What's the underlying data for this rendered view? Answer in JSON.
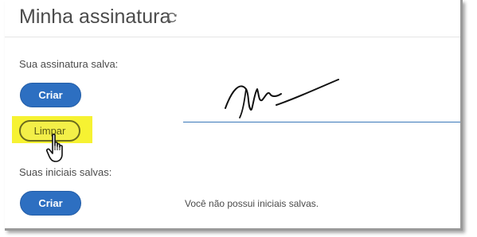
{
  "page": {
    "title": "Minha assinatura"
  },
  "signature": {
    "label": "Sua assinatura salva:",
    "create_label": "Criar",
    "clear_label": "Limpar"
  },
  "initials": {
    "label": "Suas iniciais salvas:",
    "create_label": "Criar",
    "empty_message": "Você não possui iniciais salvas."
  },
  "icons": {
    "refresh": "refresh-icon",
    "cursor": "hand-pointer-icon"
  },
  "colors": {
    "primary_button": "#2d6fc1",
    "highlight": "#f6f232",
    "signature_line": "#3a78b8"
  }
}
